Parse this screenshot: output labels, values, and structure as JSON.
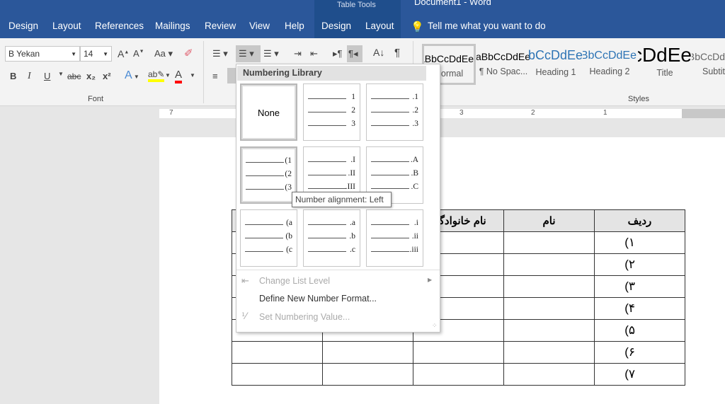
{
  "title_bar": {
    "context_group": "Table Tools",
    "document_title": "Document1 - Word"
  },
  "tabs": [
    "Design",
    "Layout",
    "References",
    "Mailings",
    "Review",
    "View",
    "Help",
    "Design",
    "Layout"
  ],
  "tell_me": "Tell me what you want to do",
  "font": {
    "name": "B Yekan",
    "size": "14",
    "group_label": "Font",
    "buttons": {
      "bold": "B",
      "italic": "I",
      "underline": "U",
      "strike": "abc",
      "subscript": "x₂",
      "superscript": "x²",
      "case": "Aa"
    }
  },
  "styles": {
    "group_label": "Styles",
    "items": [
      {
        "preview": "AaBbCcDdEe",
        "name": "Normal"
      },
      {
        "preview": "AaBbCcDdEe",
        "name": "¶ No Spac..."
      },
      {
        "preview": "AaBbCcDdEe",
        "name": "Heading 1"
      },
      {
        "preview": "AaBbCcDdEe",
        "name": "Heading 2"
      },
      {
        "preview": "AaBbCcDdEe",
        "name": "Title"
      },
      {
        "preview": "AaBbCcDd",
        "name": "Subtitle"
      }
    ]
  },
  "ruler": [
    "7",
    "3",
    "2",
    "1"
  ],
  "numbering_menu": {
    "header": "Numbering Library",
    "none_label": "None",
    "formats": [
      [
        "1",
        "2",
        "3"
      ],
      [
        ".1",
        ".2",
        ".3"
      ],
      [
        "(1",
        "(2",
        "(3"
      ],
      [
        ".I",
        ".II",
        ".III"
      ],
      [
        ".A",
        ".B",
        ".C"
      ],
      [
        "(a",
        "(b",
        "(c"
      ],
      [
        ".a",
        ".b",
        ".c"
      ],
      [
        ".i",
        ".ii",
        ".iii"
      ]
    ],
    "items": [
      {
        "label": "Change List Level",
        "enabled": false
      },
      {
        "label": "Define New Number Format...",
        "enabled": true
      },
      {
        "label": "Set Numbering Value...",
        "enabled": false
      }
    ]
  },
  "tooltip": "Number alignment: Left",
  "table": {
    "headers": [
      "",
      "",
      "نام خانوادگی",
      "نام",
      "ردیف"
    ],
    "row_numbers": [
      "(۱",
      "(۲",
      "(۳",
      "(۴",
      "(۵",
      "(۶",
      "(۷"
    ]
  },
  "colors": {
    "title_bar": "#2b579a",
    "highlight": "#ffff00",
    "font_color": "#ff0000"
  }
}
